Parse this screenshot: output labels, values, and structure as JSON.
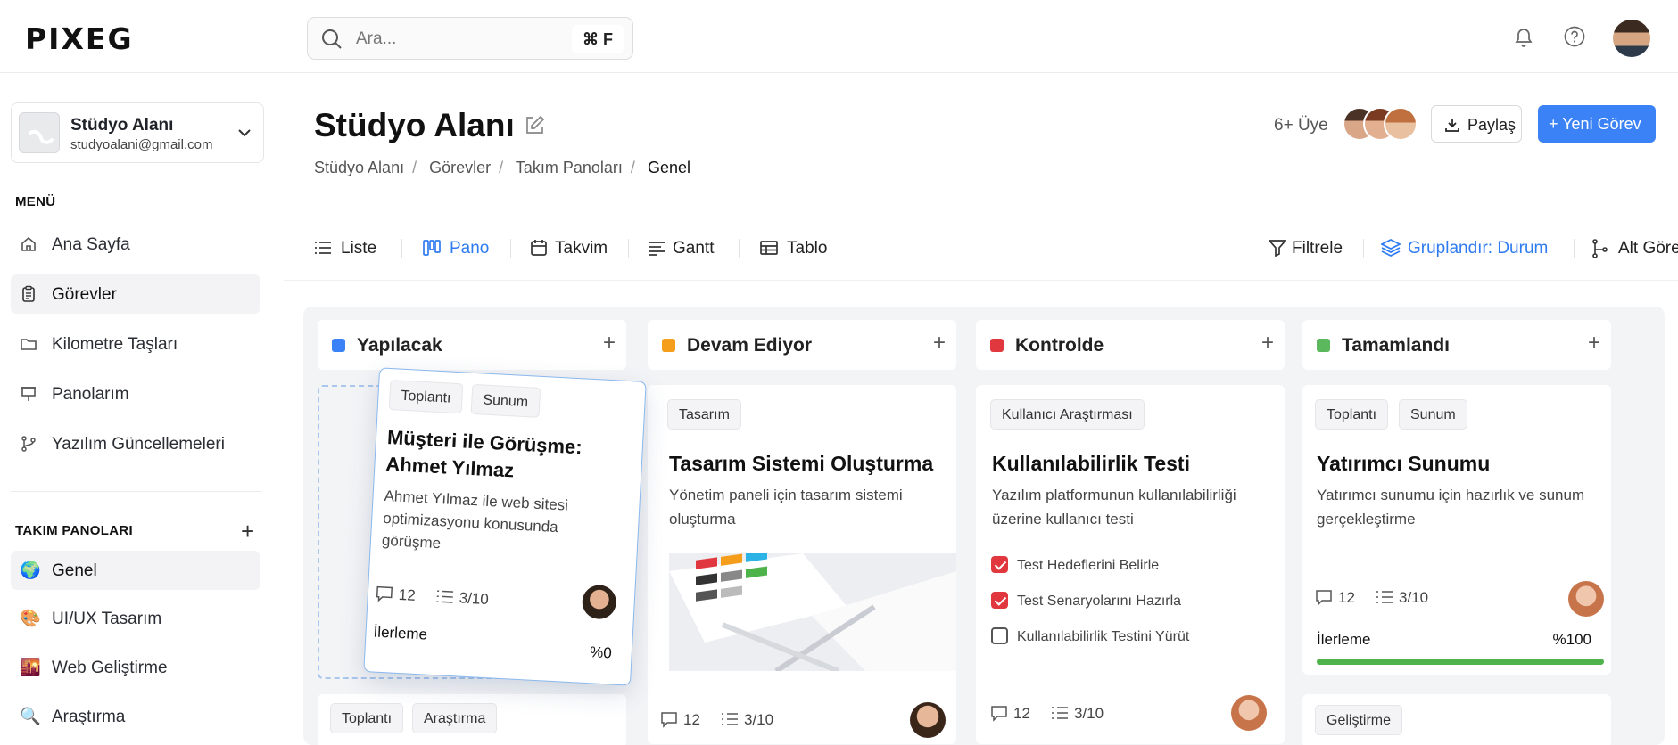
{
  "app": {
    "logo": "PIXEG"
  },
  "search": {
    "placeholder": "Ara...",
    "shortcut": "⌘ F"
  },
  "workspace": {
    "name": "Stüdyo Alanı",
    "email": "studyoalani@gmail.com"
  },
  "sidebar": {
    "menu_label": "MENÜ",
    "menu": [
      {
        "label": "Ana Sayfa",
        "icon": "home-icon"
      },
      {
        "label": "Görevler",
        "icon": "clipboard-icon",
        "active": true
      },
      {
        "label": "Kilometre Taşları",
        "icon": "folder-icon"
      },
      {
        "label": "Panolarım",
        "icon": "presentation-board-icon"
      },
      {
        "label": "Yazılım Güncellemeleri",
        "icon": "git-branch-icon"
      }
    ],
    "teams_label": "TAKIM PANOLARI",
    "teams": [
      {
        "label": "Genel",
        "icon": "🌍",
        "active": true
      },
      {
        "label": "UI/UX Tasarım",
        "icon": "🎨"
      },
      {
        "label": "Web Geliştirme",
        "icon": "🌇"
      },
      {
        "label": "Araştırma",
        "icon": "🔍"
      }
    ]
  },
  "page": {
    "title": "Stüdyo Alanı",
    "breadcrumb": [
      "Stüdyo Alanı",
      "Görevler",
      "Takım Panoları",
      "Genel"
    ],
    "members": "6+ Üye",
    "share": "Paylaş",
    "new_task": "+ Yeni Görev"
  },
  "views": {
    "tabs": [
      {
        "label": "Liste",
        "icon": "list-icon"
      },
      {
        "label": "Pano",
        "icon": "kanban-icon",
        "active": true
      },
      {
        "label": "Takvim",
        "icon": "calendar-icon"
      },
      {
        "label": "Gantt",
        "icon": "gantt-icon"
      },
      {
        "label": "Tablo",
        "icon": "table-icon"
      }
    ],
    "filter": "Filtrele",
    "group": "Gruplandır: Durum",
    "subtasks": "Alt Görevler"
  },
  "columns": [
    {
      "name": "Yapılacak",
      "color": "#3b82f6"
    },
    {
      "name": "Devam Ediyor",
      "color": "#f59e1b"
    },
    {
      "name": "Kontrolde",
      "color": "#e0383e"
    },
    {
      "name": "Tamamlandı",
      "color": "#5cb85c"
    }
  ],
  "cards": {
    "drag": {
      "tags": [
        "Toplantı",
        "Sunum"
      ],
      "title": "Müşteri ile Görüşme: Ahmet Yılmaz",
      "desc": "Ahmet Yılmaz ile web sitesi optimizasyonu konusunda görüşme",
      "comments": "12",
      "tasks": "3/10",
      "progress_label": "İlerleme",
      "progress": "%0"
    },
    "todo_next": {
      "tags": [
        "Toplantı",
        "Araştırma"
      ]
    },
    "design": {
      "tag": "Tasarım",
      "title": "Tasarım Sistemi Oluşturma",
      "desc": "Yönetim paneli için tasarım sistemi oluşturma",
      "comments": "12",
      "tasks": "3/10"
    },
    "usability": {
      "tag": "Kullanıcı Araştırması",
      "title": "Kullanılabilirlik Testi",
      "desc": "Yazılım platformunun kullanılabilirliği üzerine kullanıcı testi",
      "checklist": [
        {
          "label": "Test Hedeflerini Belirle",
          "done": true
        },
        {
          "label": "Test Senaryolarını Hazırla",
          "done": true
        },
        {
          "label": "Kullanılabilirlik Testini Yürüt",
          "done": false
        }
      ],
      "comments": "12",
      "tasks": "3/10"
    },
    "investor": {
      "tags": [
        "Toplantı",
        "Sunum"
      ],
      "title": "Yatırımcı Sunumu",
      "desc": "Yatırımcı sunumu için hazırlık ve sunum gerçekleştirme",
      "comments": "12",
      "tasks": "3/10",
      "progress_label": "İlerleme",
      "progress": "%100",
      "progress_value": 1.0
    },
    "dev_next": {
      "tag": "Geliştirme"
    }
  }
}
